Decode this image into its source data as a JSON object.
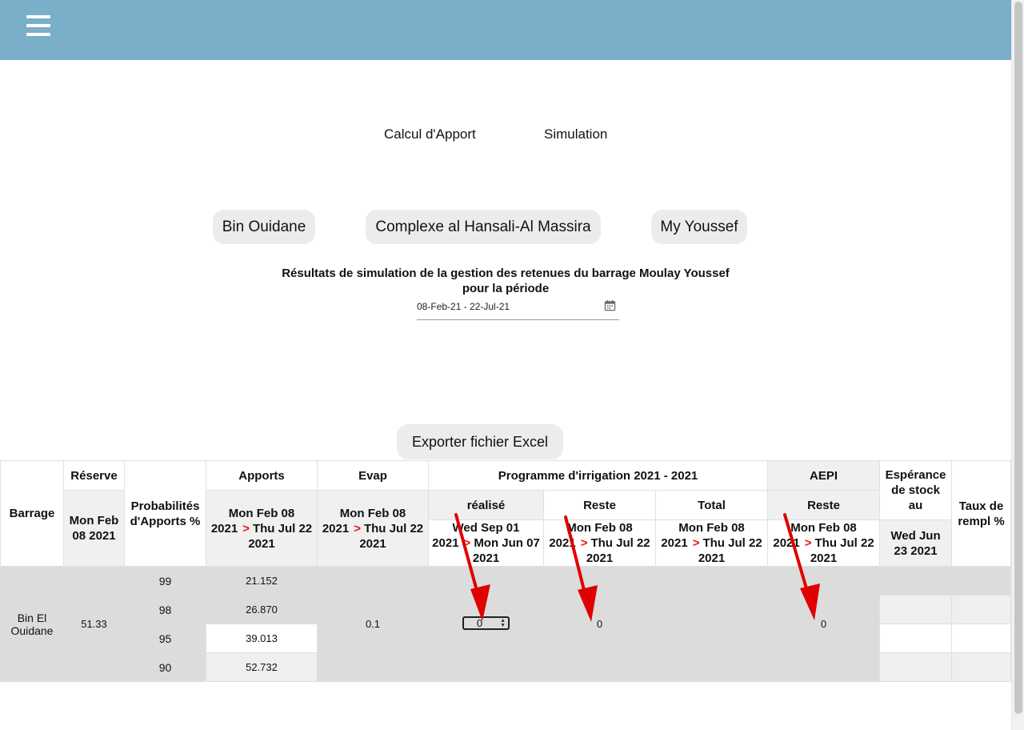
{
  "header": {
    "menu_icon": "hamburger-menu-icon"
  },
  "nav": {
    "calcul_apport": "Calcul d'Apport",
    "simulation": "Simulation"
  },
  "dams": [
    "Bin Ouidane",
    "Complexe al Hansali-Al Massira",
    "My Youssef"
  ],
  "results": {
    "title_line1": "Résultats de simulation de la gestion des retenues du barrage Moulay Youssef",
    "title_line2": "pour la période",
    "date_range": "08-Feb-21 - 22-Jul-21",
    "date_icon": "calendar-icon"
  },
  "export_label": "Exporter fichier Excel",
  "table": {
    "h": {
      "barrage": "Barrage",
      "reserve": "Réserve",
      "proba": "Probabilités d'Apports %",
      "apports": "Apports",
      "evap": "Evap",
      "programme": "Programme d'irrigation 2021 - 2021",
      "aepi": "AEPI",
      "esperance": "Espérance de stock au",
      "taux": "Taux de rempl %",
      "realise": "réalisé",
      "reste": "Reste",
      "total": "Total",
      "aepi_reste": "Reste",
      "arrow": ">",
      "reserve_date": "Mon Feb 08 2021",
      "apports_from": "Mon Feb 08 2021",
      "apports_to": "Thu Jul 22 2021",
      "evap_from": "Mon Feb 08 2021",
      "evap_to": "Thu Jul 22 2021",
      "realise_from": "Wed Sep 01 2021",
      "realise_to": "Mon Jun 07 2021",
      "reste_from": "Mon Feb 08 2021",
      "reste_to": "Thu Jul 22 2021",
      "total_from": "Mon Feb 08 2021",
      "total_to": "Thu Jul 22 2021",
      "aepi_from": "Mon Feb 08 2021",
      "aepi_to": "Thu Jul 22 2021",
      "esperance_date": "Wed Jun 23 2021"
    },
    "row": {
      "barrage": "Bin El Ouidane",
      "reserve": "51.33",
      "evap": "0.1",
      "realise_value": "0",
      "reste": "0",
      "aepi_reste": "0"
    },
    "probas": [
      "99",
      "98",
      "95",
      "90"
    ],
    "apports": [
      "21.152",
      "26.870",
      "39.013",
      "52.732"
    ]
  },
  "colors": {
    "topbar": "#7aaec9",
    "arrow": "#e00000",
    "button_bg": "#ececec",
    "row_grey": "#dcdcdc"
  }
}
